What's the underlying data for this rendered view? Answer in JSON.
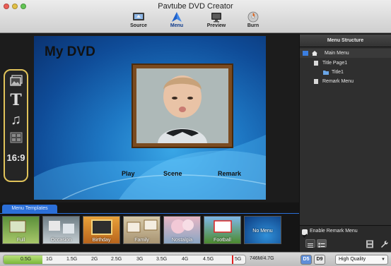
{
  "app": {
    "title": "Pavtube DVD Creator"
  },
  "toolbar": {
    "items": [
      {
        "label": "Source"
      },
      {
        "label": "Menu"
      },
      {
        "label": "Preview"
      },
      {
        "label": "Burn"
      }
    ],
    "active": "Menu"
  },
  "rail": {
    "aspect_label": "16:9"
  },
  "preview": {
    "title": "My DVD",
    "links": [
      "Play",
      "Scene",
      "Remark"
    ]
  },
  "menu_structure": {
    "header": "Menu Structure",
    "tree": [
      {
        "label": "Main Menu"
      },
      {
        "label": "Title Page1"
      },
      {
        "label": "Title1"
      },
      {
        "label": "Remark Menu"
      }
    ],
    "enable_remark_label": "Enable Remark Menu",
    "enable_remark_checked": true
  },
  "templates": {
    "tab_label": "Menu Templates",
    "items": [
      {
        "label": "Full"
      },
      {
        "label": "Occasion"
      },
      {
        "label": "Birthday"
      },
      {
        "label": "Family"
      },
      {
        "label": "Nostalgia"
      },
      {
        "label": "Football"
      },
      {
        "label": "No Menu"
      }
    ]
  },
  "status": {
    "ticks": [
      "0.5G",
      "1G",
      "1.5G",
      "2G",
      "2.5G",
      "3G",
      "3.5G",
      "4G",
      "4.5G",
      "5G"
    ],
    "capacity_text": "746M/4.7G",
    "capacity_fraction": 0.16,
    "disc_buttons": [
      "D5",
      "D9"
    ],
    "quality_value": "High Quality"
  },
  "colors": {
    "accent": "#2b6fd8",
    "rail_border": "#e0c35a"
  }
}
